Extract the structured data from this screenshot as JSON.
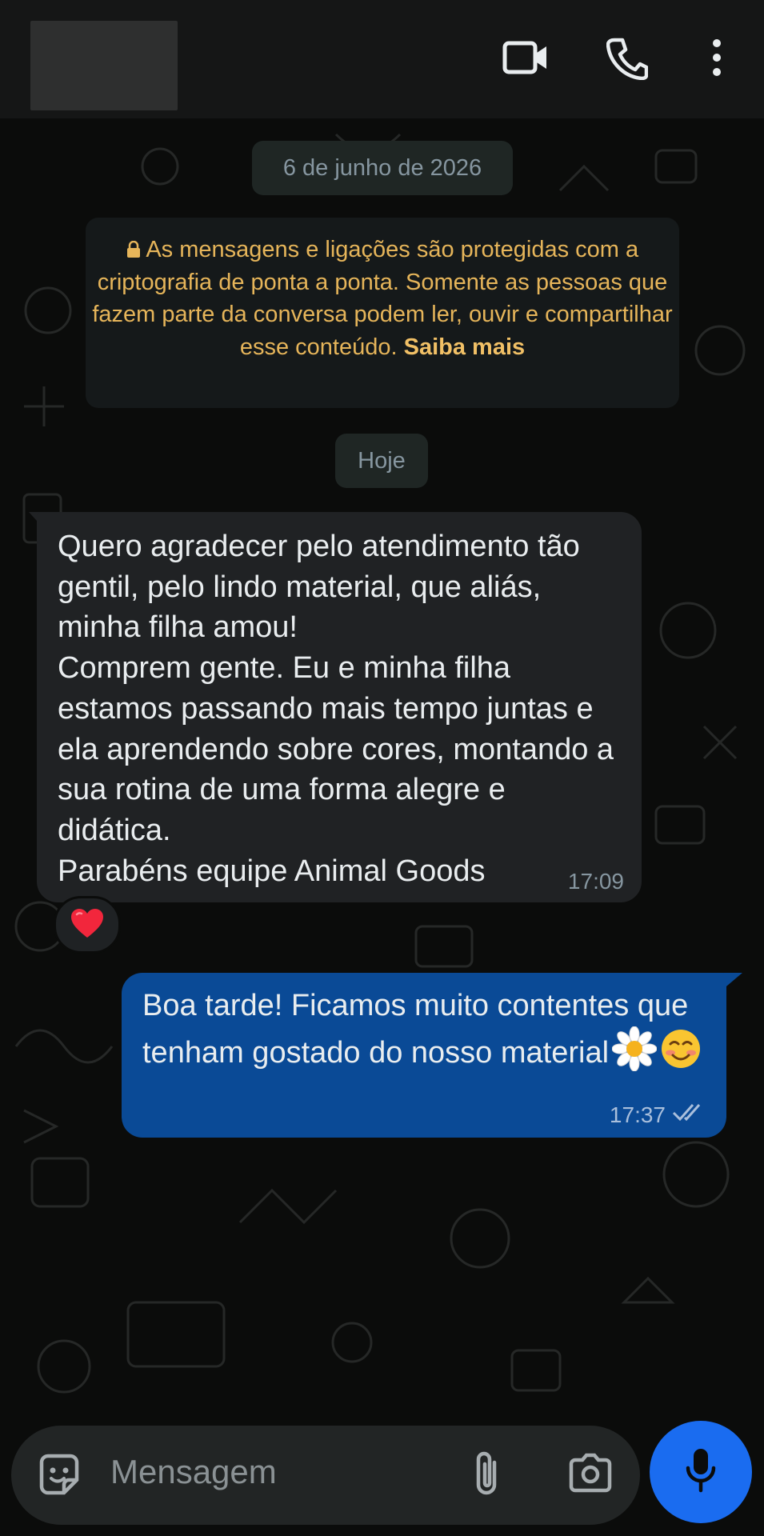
{
  "header": {
    "contact_name_redacted": true,
    "icons": [
      "video-call-icon",
      "voice-call-icon",
      "more-options-icon"
    ]
  },
  "chat": {
    "date_chip": "6 de junho de 2026",
    "encryption_notice": {
      "text": "As mensagens e ligações são protegidas com a criptografia de ponta a ponta. Somente as pessoas que fazem parte da conversa podem ler, ouvir e compartilhar esse conteúdo.",
      "link": "Saiba mais"
    },
    "today_chip": "Hoje",
    "messages": [
      {
        "direction": "incoming",
        "text": "Quero agradecer pelo atendimento tão gentil, pelo lindo material, que aliás, minha filha amou!\nComprem gente. Eu e minha filha estamos passando mais tempo juntas e ela aprendendo sobre cores, montando a sua rotina de uma forma alegre e didática.\nParabéns equipe Animal Goods",
        "time": "17:09",
        "reaction": "heart"
      },
      {
        "direction": "outgoing",
        "text": "Boa tarde! Ficamos muito contentes que tenham gostado do nosso material",
        "emojis": [
          "daisy",
          "smiling-face"
        ],
        "time": "17:37",
        "status": "read"
      }
    ]
  },
  "composer": {
    "placeholder": "Mensagem"
  },
  "colors": {
    "background": "#0b0c0b",
    "incoming_bubble": "#202224",
    "outgoing_bubble": "#0a4a96",
    "accent_mic": "#1a6cf0",
    "notice_text": "#e6b55a"
  }
}
